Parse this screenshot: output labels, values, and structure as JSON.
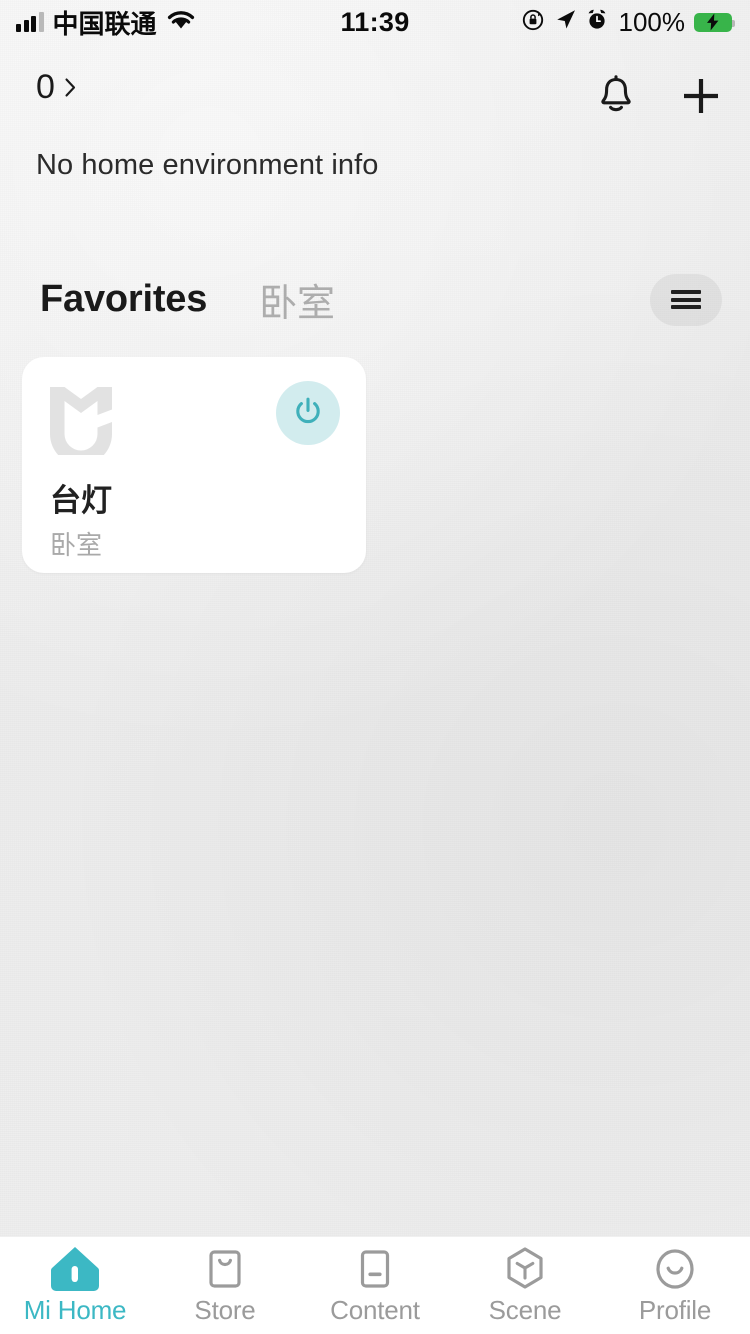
{
  "status_bar": {
    "carrier": "中国联通",
    "time": "11:39",
    "battery_percent": "100%",
    "icons": [
      "signal-icon",
      "wifi-icon",
      "rotation-lock-icon",
      "location-arrow-icon",
      "alarm-clock-icon",
      "battery-charging-icon"
    ]
  },
  "header": {
    "home_count": "0",
    "chevron": "chevron-right-icon",
    "environment_text": "No home environment info",
    "notification_icon": "bell-icon",
    "add_icon": "plus-icon"
  },
  "tabs": [
    {
      "label": "Favorites",
      "active": true
    },
    {
      "label": "卧室",
      "active": false
    }
  ],
  "menu_button": {
    "icon": "hamburger-menu-icon"
  },
  "devices": [
    {
      "name": "台灯",
      "room": "卧室",
      "brand_icon": "mijia-logo-icon",
      "power_icon": "power-icon",
      "power_on": true
    }
  ],
  "bottom_nav": [
    {
      "label": "Mi Home",
      "icon": "home-icon",
      "active": true
    },
    {
      "label": "Store",
      "icon": "shop-bag-icon",
      "active": false
    },
    {
      "label": "Content",
      "icon": "content-icon",
      "active": false
    },
    {
      "label": "Scene",
      "icon": "scene-hexagon-icon",
      "active": false
    },
    {
      "label": "Profile",
      "icon": "profile-smiley-icon",
      "active": false
    }
  ],
  "colors": {
    "accent": "#3cb8c4",
    "power_bg": "#d2ecee",
    "power_fg": "#3fb0ba",
    "background": "#eeeeee",
    "card": "#ffffff",
    "inactive_text": "#9b9b9b",
    "battery_green": "#38b44a"
  }
}
